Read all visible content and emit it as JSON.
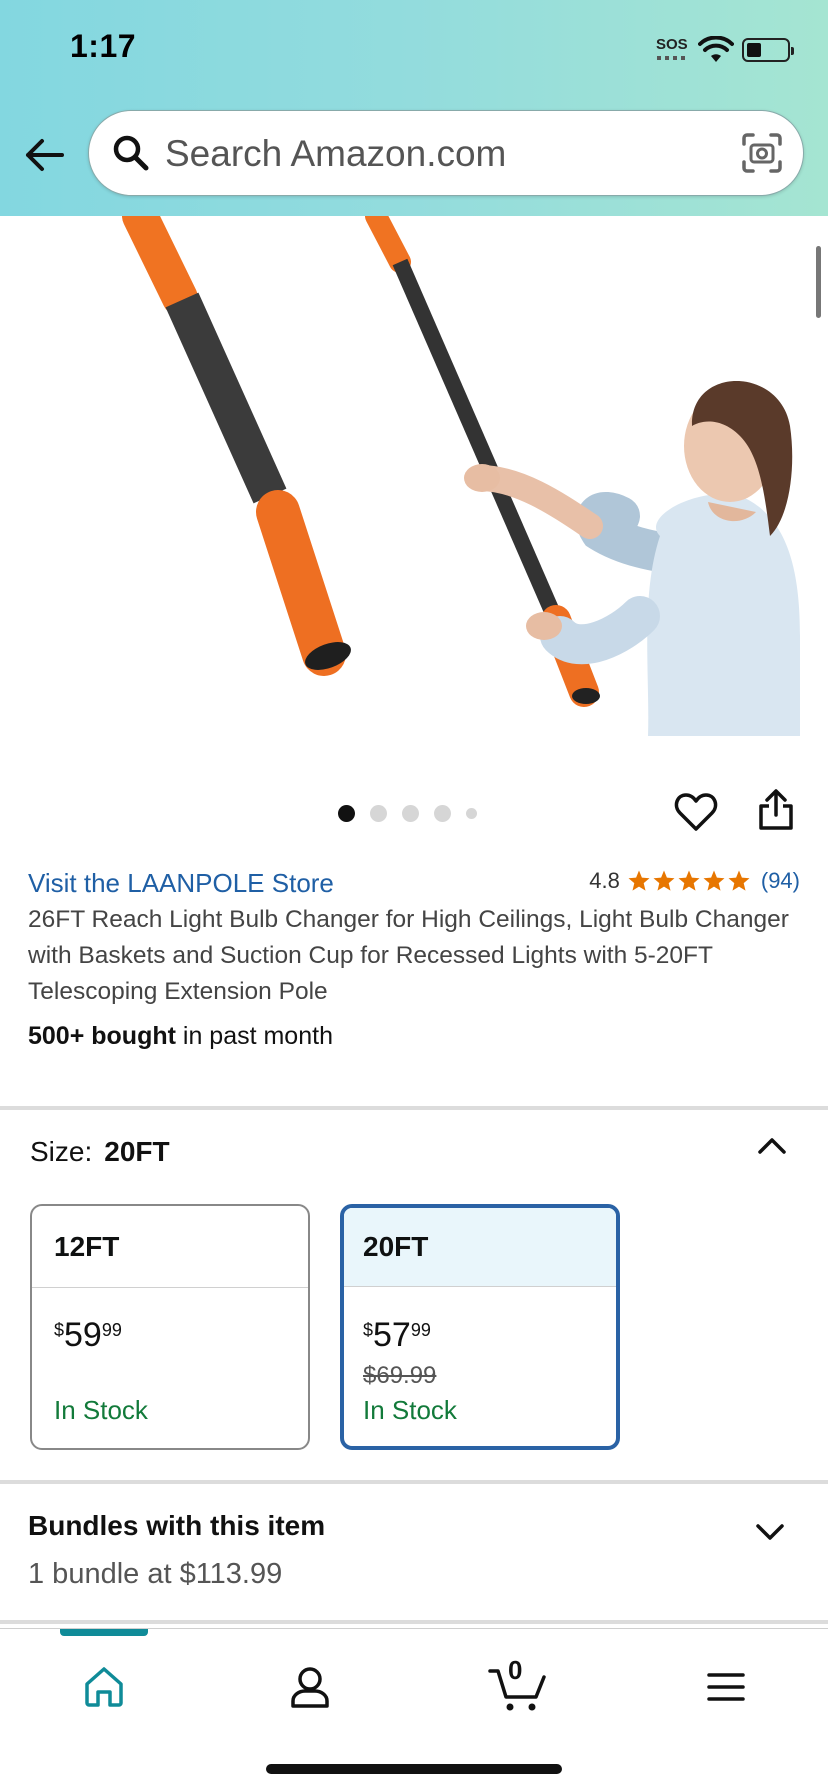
{
  "status_bar": {
    "time": "1:17",
    "sos": "SOS"
  },
  "search": {
    "placeholder": "Search Amazon.com"
  },
  "gallery": {
    "dots": 5,
    "active_index": 0
  },
  "product": {
    "store_link": "Visit the LAANPOLE Store",
    "rating": "4.8",
    "rating_count": "(94)",
    "title": "26FT Reach Light Bulb Changer for High Ceilings, Light Bulb Changer with Baskets and Suction Cup for Recessed Lights with 5-20FT Telescoping Extension Pole",
    "bought_bold": "500+ bought",
    "bought_rest": " in past month"
  },
  "size_selector": {
    "label": "Size:",
    "selected": "20FT",
    "options": [
      {
        "name": "12FT",
        "price_symbol": "$",
        "price_whole": "59",
        "price_cents": "99",
        "old_price": "",
        "stock": "In Stock"
      },
      {
        "name": "20FT",
        "price_symbol": "$",
        "price_whole": "57",
        "price_cents": "99",
        "old_price": "$69.99",
        "stock": "In Stock"
      }
    ]
  },
  "bundles": {
    "title": "Bundles with this item",
    "subtitle": "1 bundle at $113.99"
  },
  "bottom_nav": {
    "cart_count": "0",
    "active": "home"
  },
  "colors": {
    "accent": "#0f8b98",
    "link": "#1f5fa5",
    "star": "#e77600",
    "stock": "#127a3a",
    "selected_border": "#2a62a5"
  }
}
